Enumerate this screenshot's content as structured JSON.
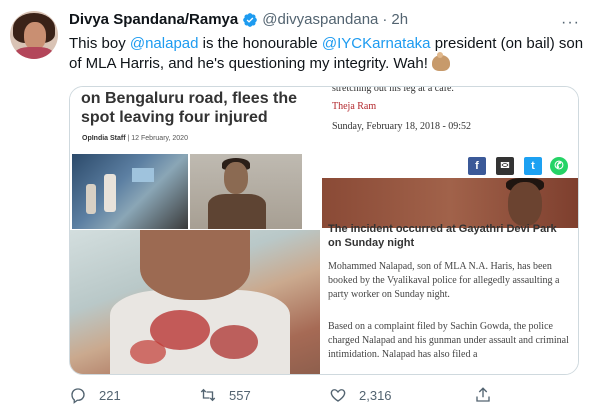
{
  "tweet": {
    "name": "Divya Spandana/Ramya",
    "handle": "@divyaspandana",
    "dot": "·",
    "time": "2h",
    "text": {
      "t1": "This boy ",
      "m1": "@nalapad",
      "t2": " is the honourable ",
      "m2": "@IYCKarnataka",
      "t3": " president (on bail) son of MLA Harris, and he's questioning my integrity. Wah!"
    },
    "more": "···"
  },
  "media": {
    "left_card": {
      "headline": "on Bengaluru road, flees the spot leaving four injured",
      "author": "OpIndia Staff",
      "date": "| 12 February, 2020"
    },
    "right_card": {
      "cut_line": "stretching out his leg at a cafe.",
      "author": "Theja Ram",
      "date": "Sunday, February 18, 2018 - 09:52",
      "share_fb": "f",
      "share_mail": "✉",
      "share_tw": "t",
      "share_wa": "✆",
      "subheading": "The incident occurred at Gayathri Devi Park on Sunday night",
      "para1": "Mohammed Nalapad, son of MLA N.A. Haris, has been booked by the Vyalikaval police for allegedly assaulting a party worker on Sunday night.",
      "para2": "Based on a complaint filed by Sachin Gowda, the police charged Nalapad and his gunman under assault and criminal intimidation. Nalapad has also filed a"
    }
  },
  "actions": {
    "reply_count": "221",
    "retweet_count": "557",
    "like_count": "2,316"
  },
  "colors": {
    "accent": "#1d9bf0",
    "text": "#0f1419",
    "secondary": "#536471"
  }
}
